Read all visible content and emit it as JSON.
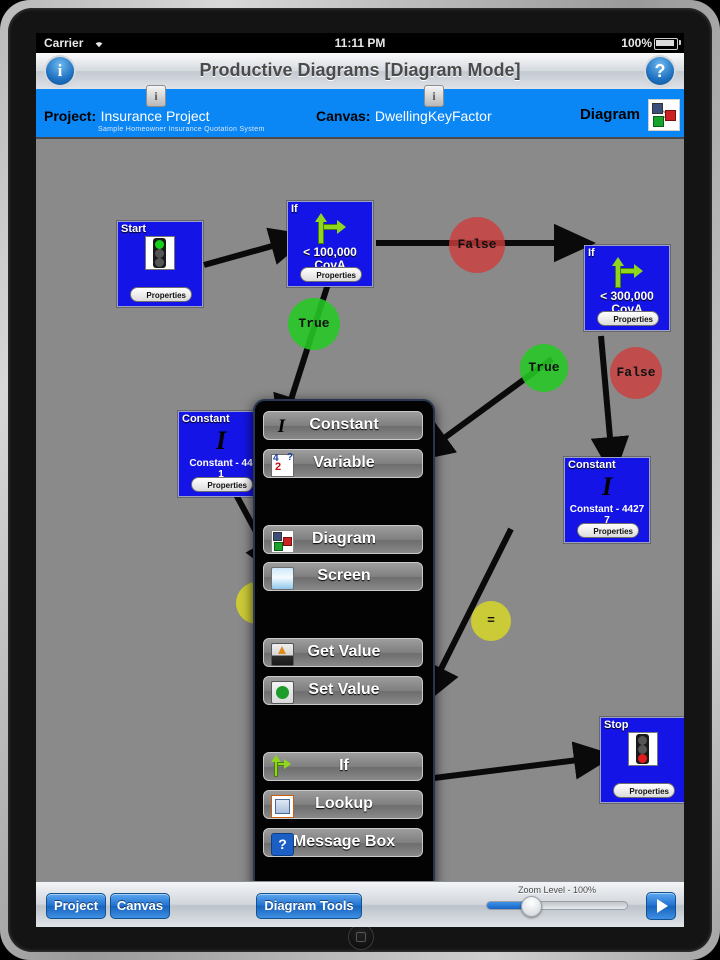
{
  "status_bar": {
    "carrier": "Carrier",
    "wifi_icon": "wifi-icon",
    "time": "11:11 PM",
    "battery": "100%"
  },
  "nav_bar": {
    "title": "Productive Diagrams [Diagram Mode]",
    "info_button": "i",
    "help_button": "?"
  },
  "project_bar": {
    "project_label": "Project:",
    "project_name": "Insurance Project",
    "project_subtitle": "Sample Homeowner Insurance Quotation System",
    "canvas_label": "Canvas:",
    "canvas_name": "DwellingKeyFactor",
    "mode_label": "Diagram",
    "info_badge": "i"
  },
  "canvas": {
    "nodes": [
      {
        "caption": "Start",
        "icon": "traffic-light-green-icon",
        "properties": "Properties"
      },
      {
        "caption": "If",
        "icon": "if-arrow-icon",
        "condition": "< 100,000 CovA",
        "properties": "Properties"
      },
      {
        "caption": "If",
        "icon": "if-arrow-icon",
        "condition": "< 300,000 CovA",
        "properties": "Properties"
      },
      {
        "caption": "Constant",
        "icon": "italic-i-icon",
        "value": "Constant - 44\n1",
        "properties": "Properties"
      },
      {
        "caption": "Constant",
        "icon": "italic-i-icon",
        "value": "Constant - 4427\n7",
        "properties": "Properties"
      },
      {
        "caption": "Stop",
        "icon": "traffic-light-red-icon",
        "properties": "Properties"
      }
    ],
    "bubbles": [
      {
        "label": "False",
        "kind": "false"
      },
      {
        "label": "True",
        "kind": "true"
      },
      {
        "label": "True",
        "kind": "true"
      },
      {
        "label": "False",
        "kind": "false"
      },
      {
        "label": "=",
        "kind": "equals"
      },
      {
        "label": "=",
        "kind": "equals"
      }
    ]
  },
  "popup_menu": {
    "title": "Diagram Tools",
    "items": [
      {
        "label": "Constant",
        "icon": "italic-i-icon"
      },
      {
        "label": "Variable",
        "icon": "variable-icon"
      },
      {
        "label": "Diagram",
        "icon": "diagram-icon"
      },
      {
        "label": "Screen",
        "icon": "screen-icon"
      },
      {
        "label": "Get Value",
        "icon": "get-value-icon"
      },
      {
        "label": "Set Value",
        "icon": "set-value-icon"
      },
      {
        "label": "If",
        "icon": "if-arrow-icon"
      },
      {
        "label": "Lookup",
        "icon": "lookup-icon"
      },
      {
        "label": "Message Box",
        "icon": "message-box-icon"
      }
    ]
  },
  "toolbar": {
    "project_button": "Project",
    "canvas_button": "Canvas",
    "diagram_tools_button": "Diagram Tools",
    "zoom_label": "Zoom Level - 100%",
    "run_button": "run-icon"
  },
  "colors": {
    "node_blue": "#1414e6",
    "bar_blue": "#0b86f5",
    "canvas_gray": "#8a8a8a",
    "accent_button": "#1e6fd0",
    "true_green": "#24c824",
    "false_red": "#cd3c3c",
    "equals_yellow": "#d6d628"
  }
}
